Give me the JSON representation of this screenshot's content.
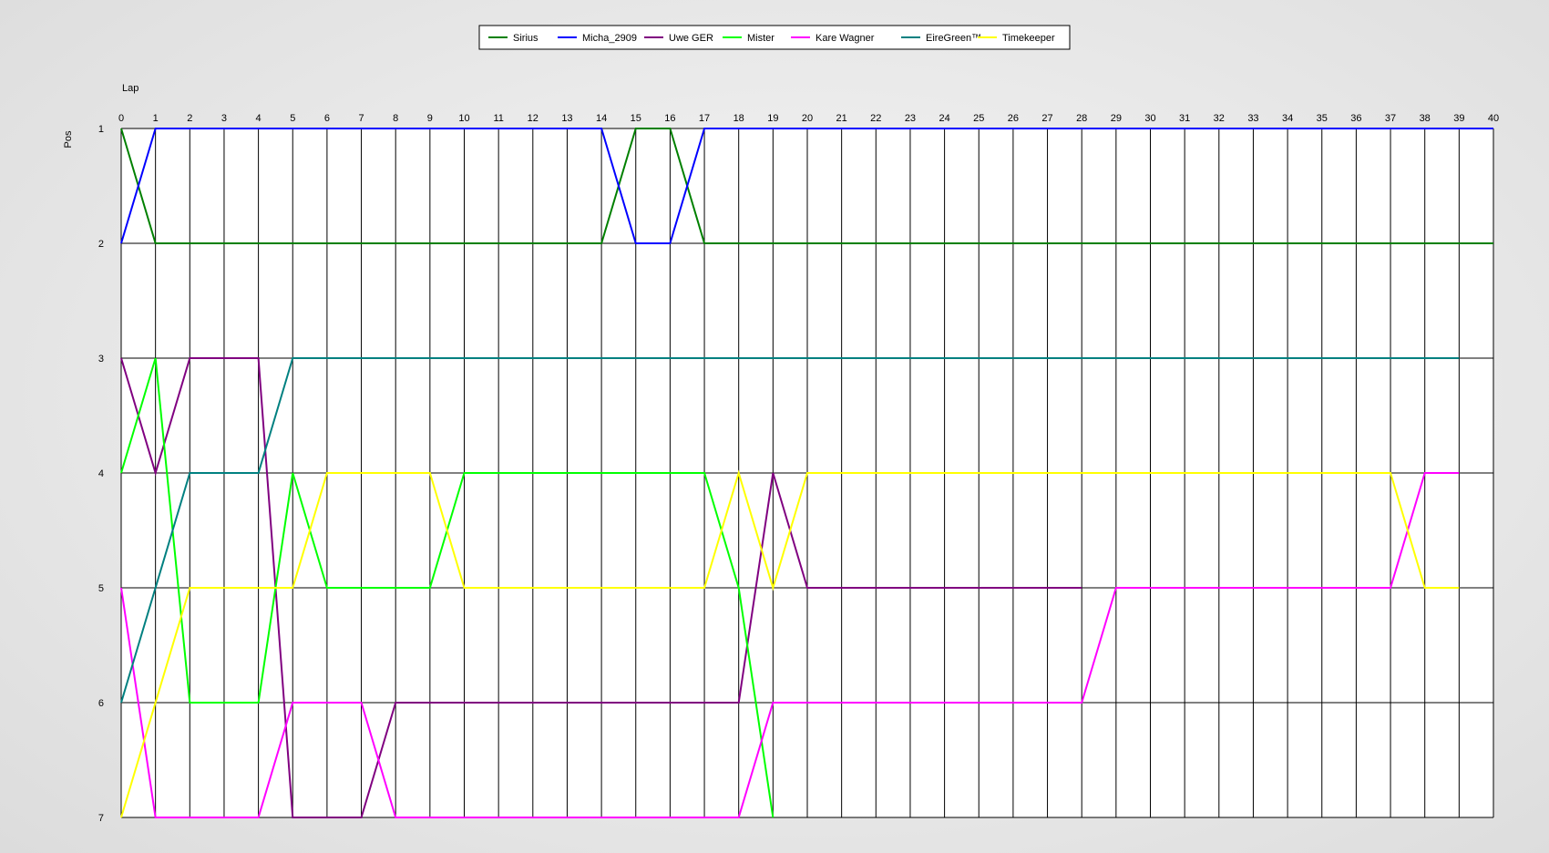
{
  "chart_data": {
    "type": "line",
    "x_label": "Lap",
    "y_label": "Pos",
    "x_range": [
      0,
      40
    ],
    "y_range": [
      1,
      7
    ],
    "y_inverted": true,
    "grid": true,
    "legend_position": "top-center",
    "x_ticks": [
      0,
      1,
      2,
      3,
      4,
      5,
      6,
      7,
      8,
      9,
      10,
      11,
      12,
      13,
      14,
      15,
      16,
      17,
      18,
      19,
      20,
      21,
      22,
      23,
      24,
      25,
      26,
      27,
      28,
      29,
      30,
      31,
      32,
      33,
      34,
      35,
      36,
      37,
      38,
      39,
      40
    ],
    "y_ticks": [
      1,
      2,
      3,
      4,
      5,
      6,
      7
    ],
    "series": [
      {
        "name": "Sirius",
        "color": "#008000",
        "x": [
          0,
          1,
          2,
          3,
          4,
          5,
          6,
          7,
          8,
          9,
          10,
          11,
          12,
          13,
          14,
          15,
          16,
          17,
          18,
          19,
          20,
          21,
          22,
          23,
          24,
          25,
          26,
          27,
          28,
          29,
          30,
          31,
          32,
          33,
          34,
          35,
          36,
          37,
          38,
          39,
          40
        ],
        "y": [
          1,
          2,
          2,
          2,
          2,
          2,
          2,
          2,
          2,
          2,
          2,
          2,
          2,
          2,
          2,
          1,
          1,
          2,
          2,
          2,
          2,
          2,
          2,
          2,
          2,
          2,
          2,
          2,
          2,
          2,
          2,
          2,
          2,
          2,
          2,
          2,
          2,
          2,
          2,
          2,
          2
        ]
      },
      {
        "name": "Micha_2909",
        "color": "#0000ff",
        "x": [
          0,
          1,
          2,
          3,
          4,
          5,
          6,
          7,
          8,
          9,
          10,
          11,
          12,
          13,
          14,
          15,
          16,
          17,
          18,
          19,
          20,
          21,
          22,
          23,
          24,
          25,
          26,
          27,
          28,
          29,
          30,
          31,
          32,
          33,
          34,
          35,
          36,
          37,
          38,
          39,
          40
        ],
        "y": [
          2,
          1,
          1,
          1,
          1,
          1,
          1,
          1,
          1,
          1,
          1,
          1,
          1,
          1,
          1,
          2,
          2,
          1,
          1,
          1,
          1,
          1,
          1,
          1,
          1,
          1,
          1,
          1,
          1,
          1,
          1,
          1,
          1,
          1,
          1,
          1,
          1,
          1,
          1,
          1,
          1
        ]
      },
      {
        "name": "Uwe GER",
        "color": "#800080",
        "x": [
          0,
          1,
          2,
          3,
          4,
          5,
          6,
          7,
          8,
          9,
          10,
          11,
          12,
          13,
          14,
          15,
          16,
          17,
          18,
          19,
          20,
          21,
          22,
          23,
          24,
          25,
          26,
          27,
          28
        ],
        "y": [
          3,
          4,
          3,
          3,
          3,
          7,
          7,
          7,
          6,
          6,
          6,
          6,
          6,
          6,
          6,
          6,
          6,
          6,
          6,
          4,
          5,
          5,
          5,
          5,
          5,
          5,
          5,
          5,
          5
        ]
      },
      {
        "name": "Mister",
        "color": "#00ff00",
        "x": [
          0,
          1,
          2,
          3,
          4,
          5,
          6,
          7,
          8,
          9,
          10,
          11,
          12,
          13,
          14,
          15,
          16,
          17,
          18,
          19
        ],
        "y": [
          4,
          3,
          6,
          6,
          6,
          4,
          5,
          5,
          5,
          5,
          4,
          4,
          4,
          4,
          4,
          4,
          4,
          4,
          5,
          7
        ]
      },
      {
        "name": "Kare Wagner",
        "color": "#ff00ff",
        "x": [
          0,
          1,
          2,
          3,
          4,
          5,
          6,
          7,
          8,
          9,
          10,
          11,
          12,
          13,
          14,
          15,
          16,
          17,
          18,
          19,
          20,
          21,
          22,
          23,
          24,
          25,
          26,
          27,
          28,
          29,
          30,
          31,
          32,
          33,
          34,
          35,
          36,
          37,
          38,
          39
        ],
        "y": [
          5,
          7,
          7,
          7,
          7,
          6,
          6,
          6,
          7,
          7,
          7,
          7,
          7,
          7,
          7,
          7,
          7,
          7,
          7,
          6,
          6,
          6,
          6,
          6,
          6,
          6,
          6,
          6,
          6,
          5,
          5,
          5,
          5,
          5,
          5,
          5,
          5,
          5,
          4,
          4
        ]
      },
      {
        "name": "EireGreen™",
        "color": "#008080",
        "x": [
          0,
          1,
          2,
          3,
          4,
          5,
          6,
          7,
          8,
          9,
          10,
          11,
          12,
          13,
          14,
          15,
          16,
          17,
          18,
          19,
          20,
          21,
          22,
          23,
          24,
          25,
          26,
          27,
          28,
          29,
          30,
          31,
          32,
          33,
          34,
          35,
          36,
          37,
          38,
          39
        ],
        "y": [
          6,
          5,
          4,
          4,
          4,
          3,
          3,
          3,
          3,
          3,
          3,
          3,
          3,
          3,
          3,
          3,
          3,
          3,
          3,
          3,
          3,
          3,
          3,
          3,
          3,
          3,
          3,
          3,
          3,
          3,
          3,
          3,
          3,
          3,
          3,
          3,
          3,
          3,
          3,
          3
        ]
      },
      {
        "name": "Timekeeper",
        "color": "#ffff00",
        "x": [
          0,
          1,
          2,
          3,
          4,
          5,
          6,
          7,
          8,
          9,
          10,
          11,
          12,
          13,
          14,
          15,
          16,
          17,
          18,
          19,
          20,
          21,
          22,
          23,
          24,
          25,
          26,
          27,
          28,
          29,
          30,
          31,
          32,
          33,
          34,
          35,
          36,
          37,
          38,
          39
        ],
        "y": [
          7,
          6,
          5,
          5,
          5,
          5,
          4,
          4,
          4,
          4,
          5,
          5,
          5,
          5,
          5,
          5,
          5,
          5,
          4,
          5,
          4,
          4,
          4,
          4,
          4,
          4,
          4,
          4,
          4,
          4,
          4,
          4,
          4,
          4,
          4,
          4,
          4,
          4,
          5,
          5
        ]
      }
    ]
  }
}
